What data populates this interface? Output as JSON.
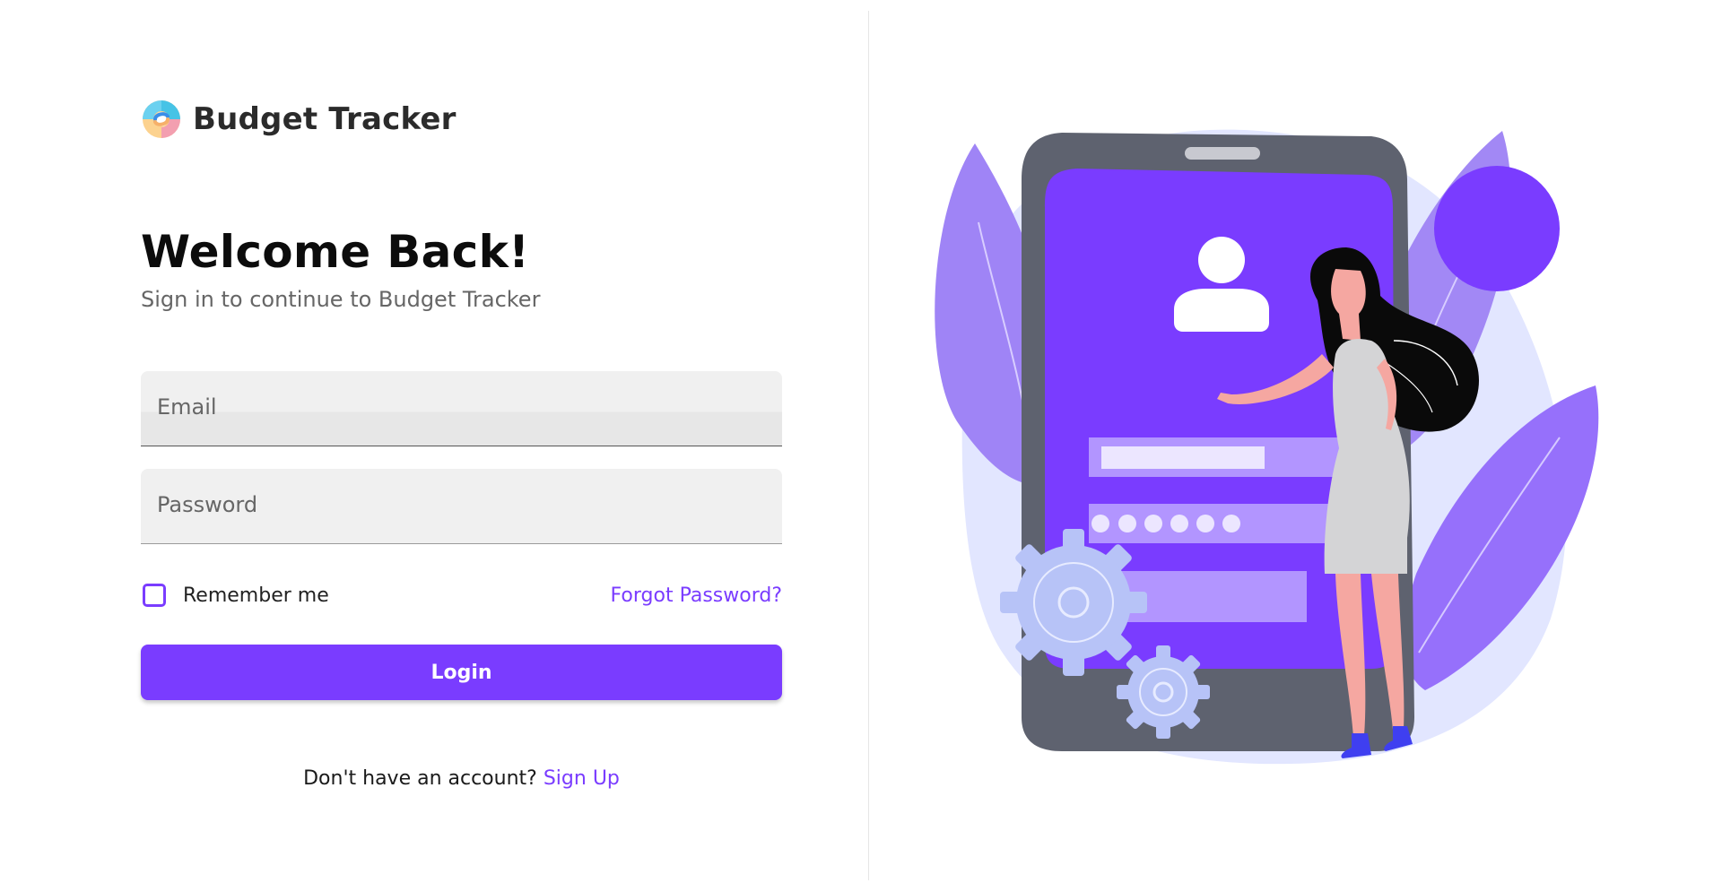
{
  "brand": {
    "name": "Budget Tracker"
  },
  "login": {
    "title": "Welcome Back!",
    "subtitle": "Sign in to continue to Budget Tracker",
    "email_label": "Email",
    "password_label": "Password",
    "remember_label": "Remember me",
    "forgot_label": "Forgot Password?",
    "login_label": "Login",
    "signup_prompt": "Don't have an account?",
    "signup_label": "Sign Up"
  },
  "colors": {
    "accent": "#7a3cff",
    "field_background": "#f0f0f0",
    "text_primary": "#0c0c0c",
    "text_secondary": "#666666"
  },
  "illustration": {
    "icons": [
      "user-icon",
      "gear-icon",
      "gear-icon"
    ]
  }
}
